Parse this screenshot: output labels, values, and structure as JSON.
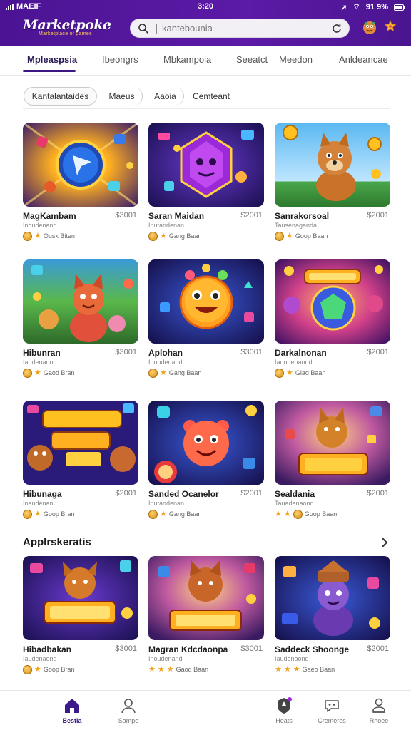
{
  "status": {
    "carrier": "MAEIF",
    "time": "3:20",
    "battery": "91 9%"
  },
  "app": {
    "name": "Marketpoke",
    "tagline": "Marketplace of games"
  },
  "search": {
    "placeholder": "kantebounia"
  },
  "tabs": [
    {
      "label": "Mpleaspsia",
      "active": true
    },
    {
      "label": "Ibeongrs"
    },
    {
      "label": "Mbkampoia"
    },
    {
      "label": "Seeatct"
    },
    {
      "label": "Meedon"
    },
    {
      "label": "Anldeancae"
    }
  ],
  "chips": [
    {
      "label": "Kantalantaides",
      "selected": true
    },
    {
      "label": "Maeus"
    },
    {
      "label": "Aaoia"
    },
    {
      "label": "Cemteant"
    }
  ],
  "cards": [
    {
      "title": "MagKambam",
      "price": "$3001",
      "subtitle": "Inoudenand",
      "rating": "Ousk Biten",
      "stars": 1
    },
    {
      "title": "Saran Maidan",
      "price": "$2001",
      "subtitle": "Inutandenan",
      "rating": "Gang Baan",
      "stars": 1
    },
    {
      "title": "Sanrakorsoal",
      "price": "$2001",
      "subtitle": "Tausenaganda",
      "rating": "Goop Baan",
      "stars": 1
    },
    {
      "title": "Hibunran",
      "price": "$3001",
      "subtitle": "Iaudenaond",
      "rating": "Gaod Bran",
      "stars": 1
    },
    {
      "title": "Aplohan",
      "price": "$3001",
      "subtitle": "Inoudenand",
      "rating": "Gang Baan",
      "stars": 1
    },
    {
      "title": "Darkalnonan",
      "price": "$2001",
      "subtitle": "Iaundenaond",
      "rating": "Giad Baan",
      "stars": 1
    },
    {
      "title": "Hibunaga",
      "price": "$2001",
      "subtitle": "Inaudenan",
      "rating": "Goop Bran",
      "stars": 1
    },
    {
      "title": "Sanded Ocanelor",
      "price": "$2001",
      "subtitle": "Inutandenan",
      "rating": "Gang Baan",
      "stars": 1
    },
    {
      "title": "Sealdania",
      "price": "$2001",
      "subtitle": "Tauadenaond",
      "rating": "Goop Baan",
      "stars": 2
    }
  ],
  "section": {
    "title": "Applrskeratis"
  },
  "section_cards": [
    {
      "title": "Hibadbakan",
      "price": "$3001",
      "subtitle": "Iaudenaond",
      "rating": "Goop Bran",
      "stars": 1
    },
    {
      "title": "Magran Kdcdaonpa",
      "price": "$3001",
      "subtitle": "Inoudenand",
      "rating": "Gaod Baan",
      "stars": 3
    },
    {
      "title": "Saddeck Shoonge",
      "price": "$2001",
      "subtitle": "Iaudenaond",
      "rating": "Gaeo Baan",
      "stars": 3
    }
  ],
  "bottom_nav": [
    {
      "label": "Bestia",
      "icon": "home-icon",
      "active": true
    },
    {
      "label": "Sampe",
      "icon": "user-icon"
    },
    {
      "label": "Heats",
      "icon": "shield-icon"
    },
    {
      "label": "Cremeres",
      "icon": "chat-icon"
    },
    {
      "label": "Rhoee",
      "icon": "profile-icon"
    }
  ],
  "colors": {
    "brand": "#4b1494",
    "accent": "#f0a21a",
    "nav_active": "#3a1a8a"
  }
}
